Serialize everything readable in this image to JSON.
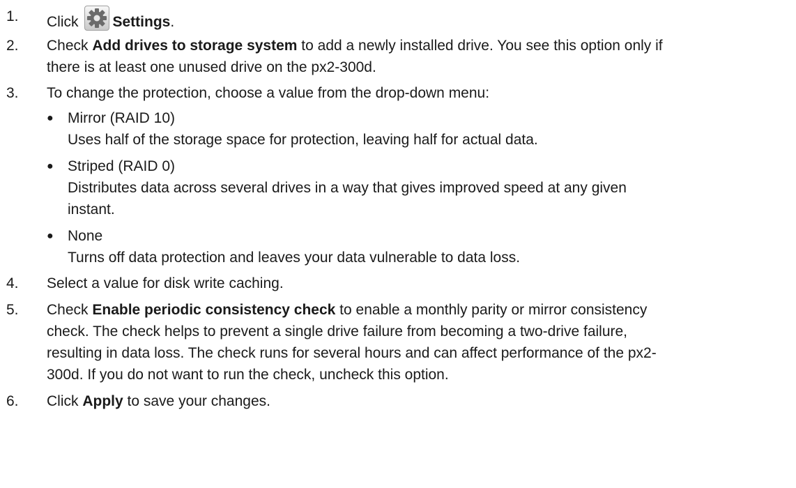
{
  "steps": [
    {
      "num": "1.",
      "pre": "Click",
      "icon": "settings-gear-icon",
      "bold": "Settings",
      "post": "."
    },
    {
      "num": "2.",
      "pre": "Check ",
      "bold": "Add drives to storage system",
      "line1_post": " to add a newly installed drive. You see this option only if",
      "line2": "there is at least one unused drive on the px2-300d."
    },
    {
      "num": "3.",
      "text": "To change the protection, choose a value from the drop-down menu:",
      "options": [
        {
          "bullet": "●",
          "title": "Mirror (RAID 10)",
          "lines": [
            "Uses half of the storage space for protection, leaving half for actual data."
          ]
        },
        {
          "bullet": "●",
          "title": "Striped (RAID 0)",
          "lines": [
            "Distributes data across several drives in a way that gives improved speed at any given",
            "instant."
          ]
        },
        {
          "bullet": "●",
          "title": "None",
          "lines": [
            "Turns off data protection and leaves your data vulnerable to data loss."
          ]
        }
      ]
    },
    {
      "num": "4.",
      "text": "Select a value for disk write caching."
    },
    {
      "num": "5.",
      "pre": "Check ",
      "bold": "Enable periodic consistency check",
      "line1_post": " to enable a monthly parity or mirror consistency",
      "lines": [
        "check. The check helps to prevent a single drive failure from becoming a two-drive failure,",
        "resulting in data loss. The check runs for several hours and can affect performance of the px2-",
        "300d. If you do not want to run the check, uncheck this option."
      ]
    },
    {
      "num": "6.",
      "pre": "Click ",
      "bold": "Apply",
      "post": " to save your changes."
    }
  ]
}
